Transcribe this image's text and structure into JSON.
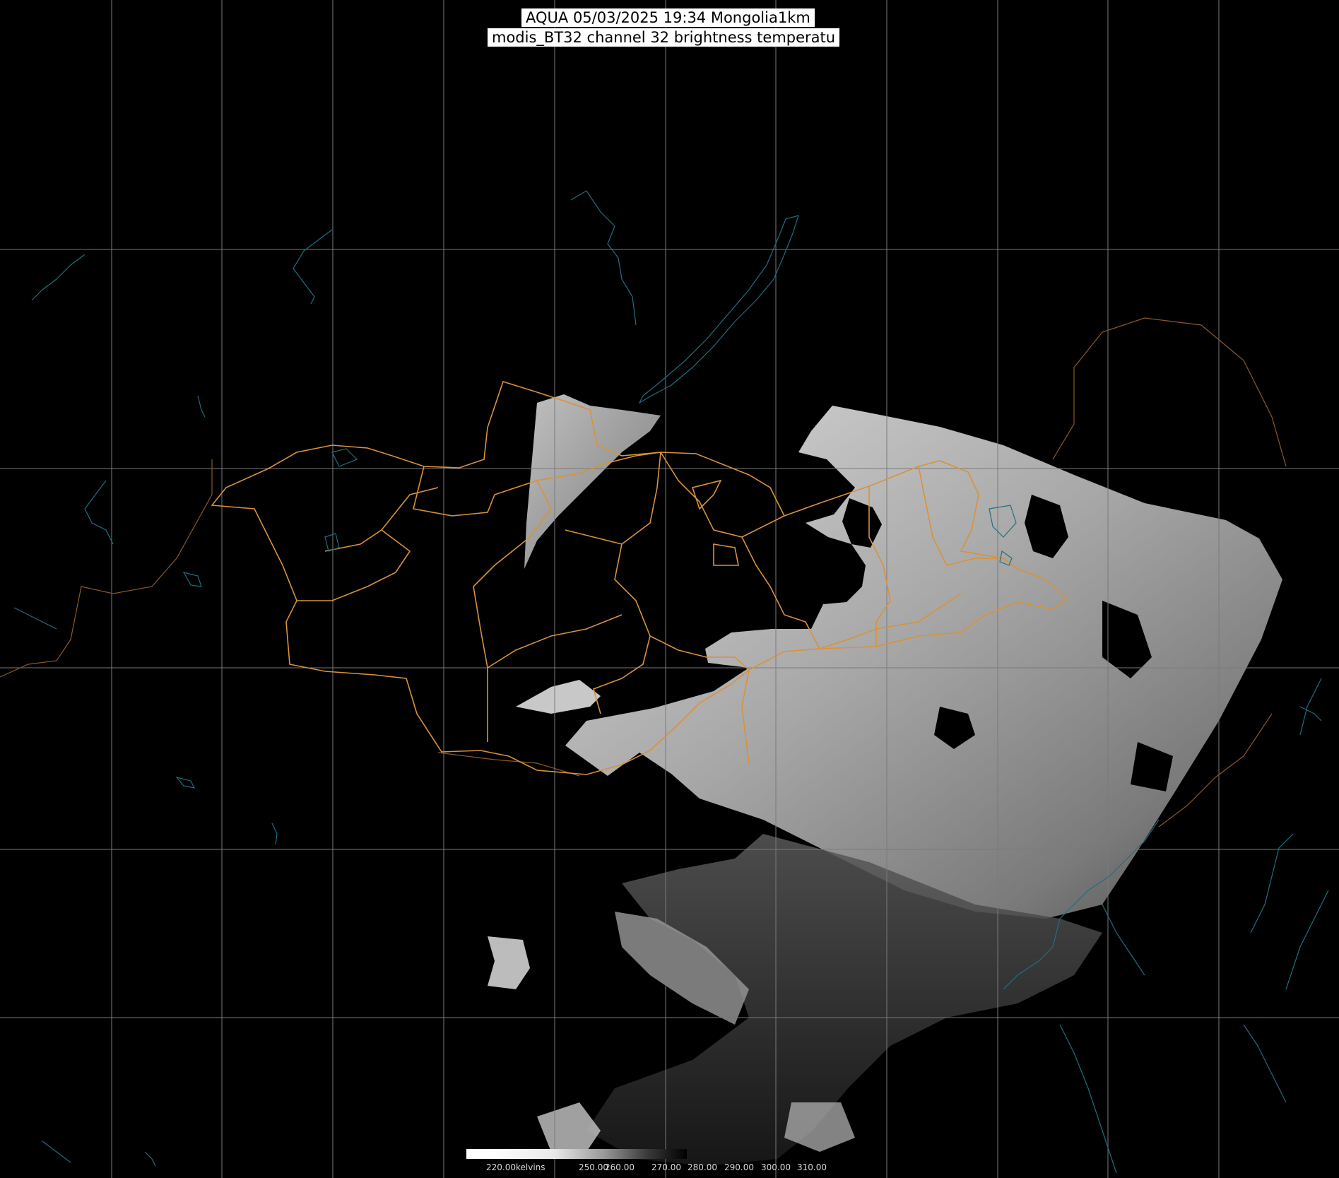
{
  "title": {
    "line1": "AQUA 05/03/2025 19:34 Mongolia1km",
    "line2": "modis_BT32 channel 32 brightness temperatu"
  },
  "colorbar": {
    "labels": [
      "220.00kelvins",
      "250.00",
      "260.00",
      "270.00",
      "280.00",
      "290.00",
      "300.00",
      "310.00"
    ],
    "min": 220,
    "max": 320,
    "unit": "kelvins"
  },
  "colors": {
    "background": "#000000",
    "grid": "#7a7a7a",
    "admin_border": "#d8923a",
    "coast_water": "#1f6f80",
    "country_border": "#8a5a2a"
  }
}
